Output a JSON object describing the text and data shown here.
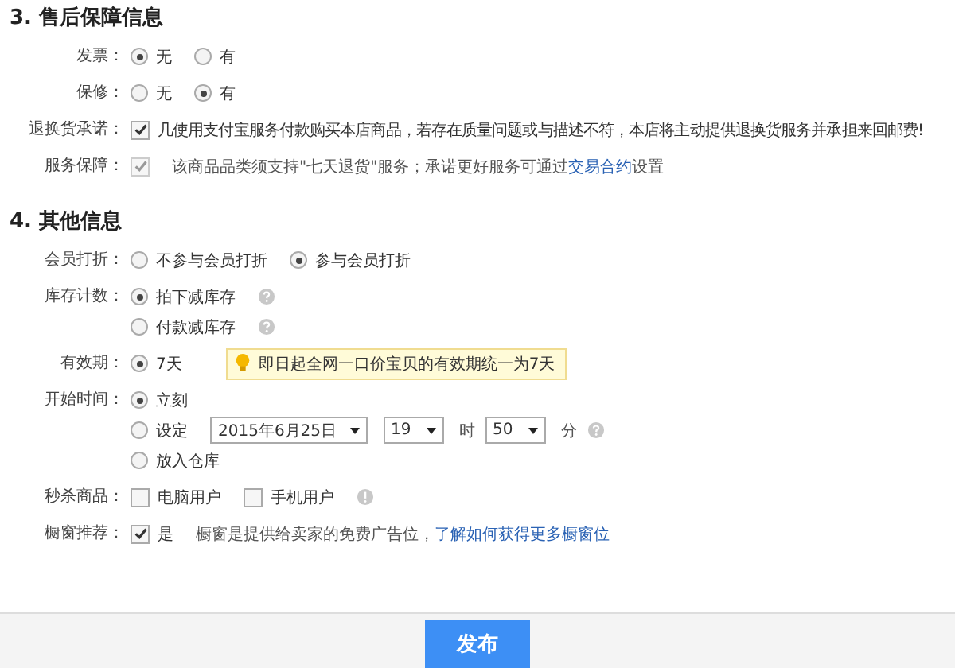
{
  "sections": [
    {
      "title": "3. 售后保障信息",
      "rows": [
        {
          "label": "发票：",
          "lines": [
            [
              {
                "kind": "radio",
                "label": "无",
                "selected": true
              },
              {
                "kind": "radio",
                "label": "有",
                "selected": false
              }
            ]
          ]
        },
        {
          "label": "保修：",
          "lines": [
            [
              {
                "kind": "radio",
                "label": "无",
                "selected": false
              },
              {
                "kind": "radio",
                "label": "有",
                "selected": true
              }
            ]
          ]
        },
        {
          "label": "退换货承诺：",
          "lines": [
            [
              {
                "kind": "checkbox",
                "checked": true,
                "disabled": false,
                "label": "几使用支付宝服务付款购买本店商品，若存在质量问题或与描述不符，本店将主动提供退换货服务并承担来回邮费!"
              }
            ]
          ]
        },
        {
          "label": "服务保障：",
          "lines": [
            [
              {
                "kind": "checkbox",
                "checked": true,
                "disabled": true
              },
              {
                "kind": "text",
                "text": "该商品品类须支持\"七天退货\"服务；承诺更好服务可通过"
              },
              {
                "kind": "link",
                "text": "交易合约"
              },
              {
                "kind": "text",
                "text": "设置"
              }
            ]
          ]
        }
      ]
    },
    {
      "title": "4. 其他信息",
      "rows": [
        {
          "label": "会员打折：",
          "lines": [
            [
              {
                "kind": "radio",
                "label": "不参与会员打折",
                "selected": false
              },
              {
                "kind": "radio",
                "label": "参与会员打折",
                "selected": true
              }
            ]
          ]
        },
        {
          "label": "库存计数：",
          "lines": [
            [
              {
                "kind": "radio",
                "label": "拍下减库存",
                "selected": true
              },
              {
                "kind": "help"
              }
            ],
            [
              {
                "kind": "radio",
                "label": "付款减库存",
                "selected": false
              },
              {
                "kind": "help"
              }
            ]
          ]
        },
        {
          "label": "有效期：",
          "lines": [
            [
              {
                "kind": "radio",
                "label": "7天",
                "selected": true
              },
              {
                "kind": "tip",
                "text": "即日起全网一口价宝贝的有效期统一为7天"
              }
            ]
          ]
        },
        {
          "label": "开始时间：",
          "lines": [
            [
              {
                "kind": "radio",
                "label": "立刻",
                "selected": true
              }
            ],
            [
              {
                "kind": "radio",
                "label": "设定",
                "selected": false
              },
              {
                "kind": "select",
                "value": "2015年6月25日"
              },
              {
                "kind": "select",
                "value": "19"
              },
              {
                "kind": "text",
                "text": "时"
              },
              {
                "kind": "select",
                "value": "50"
              },
              {
                "kind": "text",
                "text": "分"
              },
              {
                "kind": "help"
              }
            ],
            [
              {
                "kind": "radio",
                "label": "放入仓库",
                "selected": false
              }
            ]
          ]
        },
        {
          "label": "秒杀商品：",
          "lines": [
            [
              {
                "kind": "checkbox",
                "checked": false,
                "disabled": false,
                "label": "电脑用户"
              },
              {
                "kind": "checkbox",
                "checked": false,
                "disabled": false,
                "label": "手机用户"
              },
              {
                "kind": "info"
              }
            ]
          ]
        },
        {
          "label": "橱窗推荐：",
          "lines": [
            [
              {
                "kind": "checkbox",
                "checked": true,
                "disabled": false,
                "label": "是"
              },
              {
                "kind": "text",
                "text": "橱窗是提供给卖家的免费广告位，"
              },
              {
                "kind": "link",
                "text": "了解如何获得更多橱窗位"
              }
            ]
          ]
        }
      ]
    }
  ],
  "submit": {
    "label": "发布"
  }
}
